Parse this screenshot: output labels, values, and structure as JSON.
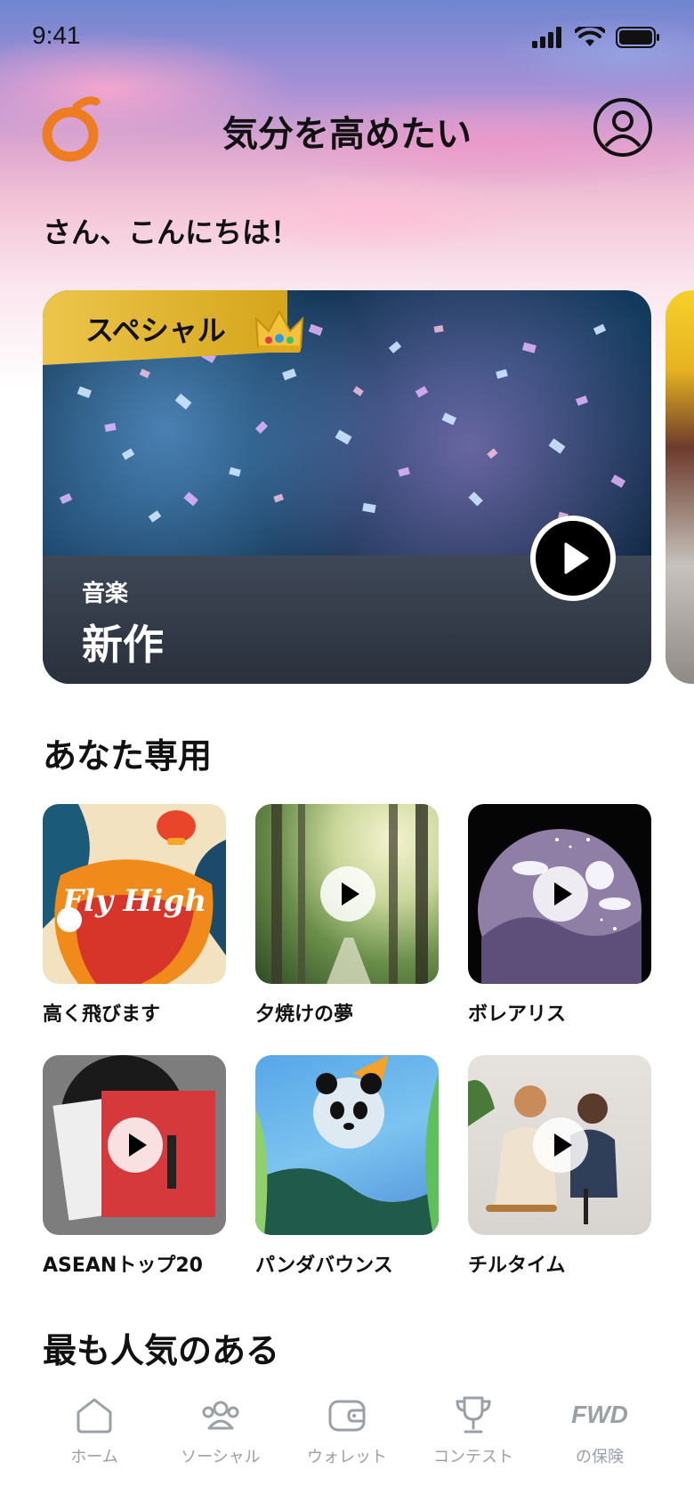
{
  "status_bar": {
    "time": "9:41"
  },
  "header": {
    "title": "気分を高めたい"
  },
  "greeting": "さん、こんにちは！",
  "hero": {
    "badge": "スペシャル",
    "category": "音楽",
    "title": "新作"
  },
  "for_you": {
    "title": "あなた専用",
    "items": [
      {
        "label": "高く飛びます",
        "art_text": "Fly High"
      },
      {
        "label": "夕焼けの夢"
      },
      {
        "label": "ボレアリス"
      },
      {
        "label": "ASEANトップ20"
      },
      {
        "label": "パンダバウンス"
      },
      {
        "label": "チルタイム"
      }
    ]
  },
  "popular": {
    "title": "最も人気のある"
  },
  "tab_bar": {
    "tabs": [
      {
        "label": "ホーム",
        "icon": "home-icon"
      },
      {
        "label": "ソーシャル",
        "icon": "people-icon"
      },
      {
        "label": "ウォレット",
        "icon": "wallet-icon"
      },
      {
        "label": "コンテスト",
        "icon": "trophy-icon"
      },
      {
        "label": "の保険",
        "icon": "fwd-logo",
        "logo_text": "FWD"
      }
    ]
  },
  "colors": {
    "accent_orange": "#ee7d21",
    "badge_gold": "#e2b62f",
    "tab_inactive": "#9aa0a8"
  }
}
